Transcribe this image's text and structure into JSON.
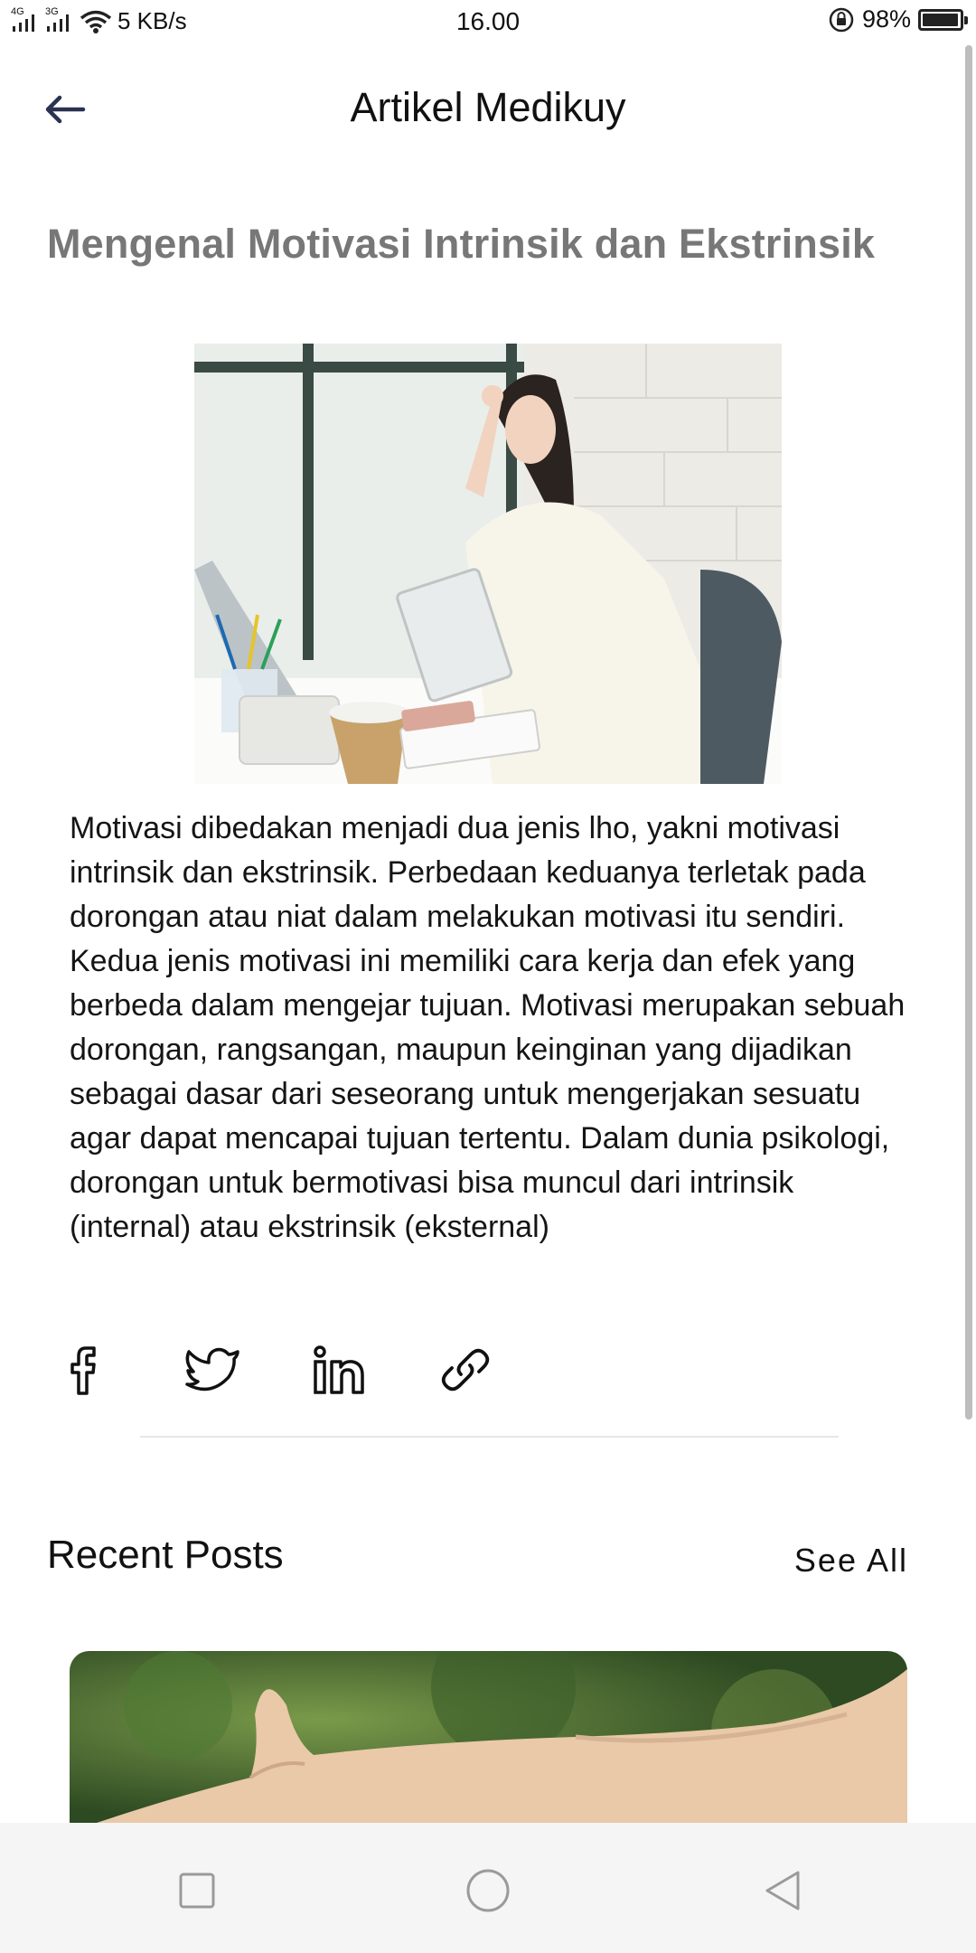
{
  "status_bar": {
    "network_label_1": "4G",
    "network_label_2": "3G",
    "speed": "5 KB/s",
    "time": "16.00",
    "battery": "98%",
    "battery_level": 0.98
  },
  "header": {
    "title": "Artikel Medikuy",
    "back_icon": "arrow-left-icon"
  },
  "article": {
    "title": "Mengenal Motivasi Intrinsik dan Ekstrinsik",
    "body": "Motivasi dibedakan menjadi dua jenis lho, yakni motivasi intrinsik dan ekstrinsik. Perbedaan keduanya terletak pada dorongan atau niat dalam melakukan motivasi itu sendiri. Kedua jenis motivasi ini memiliki cara kerja dan efek yang berbeda dalam mengejar tujuan. Motivasi merupakan sebuah dorongan, rangsangan, maupun keinginan yang dijadikan sebagai dasar dari seseorang untuk mengerjakan sesuatu agar dapat mencapai tujuan tertentu. Dalam dunia psikologi, dorongan untuk bermotivasi bisa muncul dari intrinsik (internal) atau ekstrinsik (eksternal)"
  },
  "share": {
    "icons": [
      "facebook-icon",
      "twitter-icon",
      "linkedin-icon",
      "link-icon"
    ]
  },
  "recent_posts": {
    "title": "Recent Posts",
    "see_all": "See All"
  },
  "nav": {
    "icons": [
      "recents-square-icon",
      "home-circle-icon",
      "back-triangle-icon"
    ]
  },
  "colors": {
    "article_title": "#777777",
    "text": "#111111",
    "back_arrow": "#2b3250",
    "nav_bg": "#f5f5f5"
  }
}
